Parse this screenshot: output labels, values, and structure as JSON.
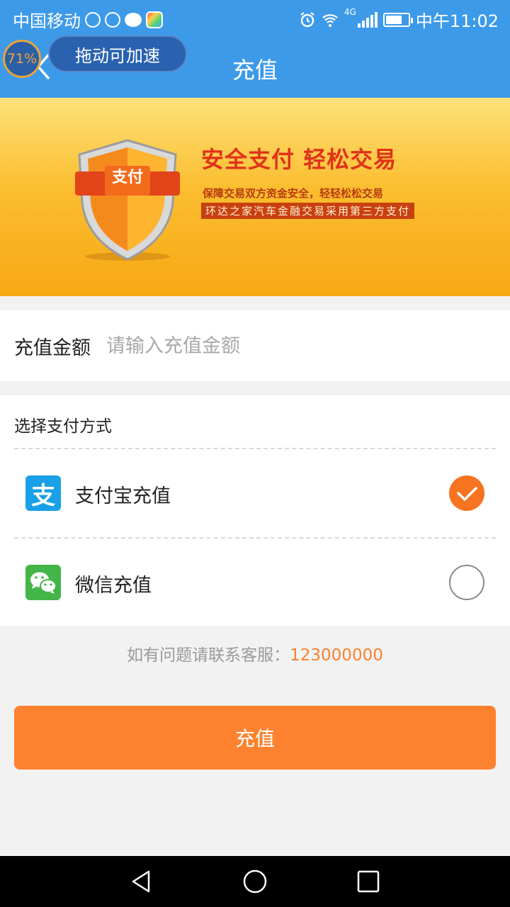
{
  "status_bar": {
    "carrier": "中国移动",
    "network": "4G",
    "time": "中午11:02",
    "battery_level": 0.75
  },
  "header": {
    "title": "充值",
    "floating_ball_percent": "71%",
    "drag_hint": "拖动可加速"
  },
  "banner": {
    "shield_text": "支付",
    "title": "安全支付  轻松交易",
    "line1": "保障交易双方资金安全，轻轻松松交易",
    "line2": "环达之家汽车金融交易采用第三方支付"
  },
  "amount": {
    "label": "充值金额",
    "placeholder": "请输入充值金额",
    "value": ""
  },
  "payment": {
    "header": "选择支付方式",
    "methods": [
      {
        "label": "支付宝充值",
        "icon": "alipay-icon",
        "icon_text": "支",
        "color": "#1aa0e6",
        "selected": true
      },
      {
        "label": "微信充值",
        "icon": "wechat-icon",
        "color": "#44b549",
        "selected": false
      }
    ]
  },
  "contact": {
    "prefix": "如有问题请联系客服：",
    "phone": "123000000"
  },
  "submit_label": "充值",
  "colors": {
    "primary": "#3d9ae8",
    "accent": "#fd822f",
    "check": "#f6731f"
  }
}
